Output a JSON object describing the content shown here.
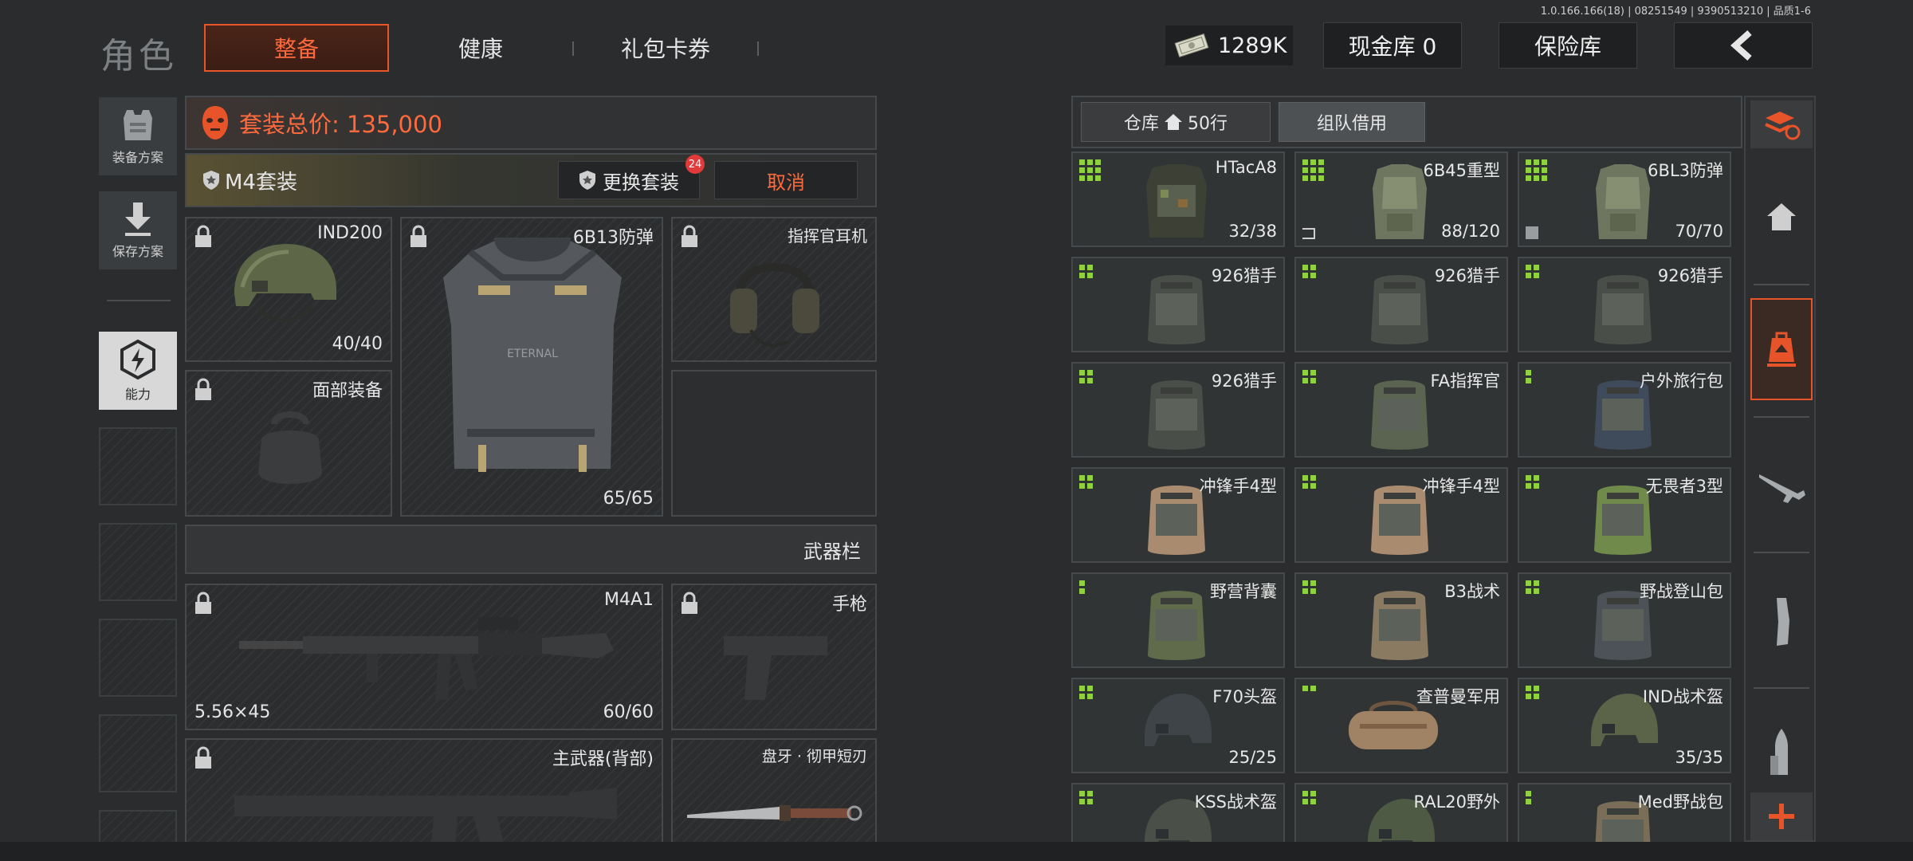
{
  "version_text": "1.0.166.166(18) | 08251549 | 9390513210 | 品质1-6",
  "header": {
    "title": "角色",
    "tabs": [
      {
        "label": "整备",
        "active": true
      },
      {
        "label": "健康",
        "active": false
      },
      {
        "label": "礼包卡券",
        "active": false
      }
    ],
    "currency_value": "1289K",
    "cash_vault_label": "现金库 0",
    "insurance_label": "保险库"
  },
  "left_rail": {
    "loadout_plan_label": "装备方案",
    "save_plan_label": "保存方案",
    "ability_label": "能力"
  },
  "loadout": {
    "total_price_label": "套装总价: 135,000",
    "set_name": "M4套装",
    "change_set_label": "更换套装",
    "change_set_badge": "24",
    "cancel_label": "取消",
    "slots": {
      "helmet": {
        "name": "IND200",
        "durability": "40/40"
      },
      "armor": {
        "name": "6B13防弹",
        "durability": "65/65"
      },
      "headset": {
        "name": "指挥官耳机"
      },
      "face": {
        "name": "面部装备"
      }
    },
    "weapon_bar_label": "武器栏",
    "weapons": {
      "primary": {
        "name": "M4A1",
        "caliber": "5.56×45",
        "durability": "60/60"
      },
      "pistol": {
        "name": "手枪"
      },
      "back": {
        "name": "主武器(背部)"
      },
      "melee": {
        "name": "盘牙 · 彻甲短刃"
      }
    }
  },
  "storage": {
    "warehouse_label": "仓库",
    "warehouse_rows": "50行",
    "team_borrow_label": "组队借用",
    "items": [
      {
        "name": "HTacA8",
        "durability": "32/38",
        "grid": "3x3",
        "kind": "vest"
      },
      {
        "name": "6B45重型",
        "durability": "88/120",
        "grid": "3x3",
        "kind": "armor"
      },
      {
        "name": "6BL3防弹",
        "durability": "70/70",
        "grid": "3x3",
        "kind": "armor"
      },
      {
        "name": "926猎手",
        "durability": "",
        "grid": "2x2",
        "kind": "bag"
      },
      {
        "name": "926猎手",
        "durability": "",
        "grid": "2x2",
        "kind": "bag"
      },
      {
        "name": "926猎手",
        "durability": "",
        "grid": "2x2",
        "kind": "bag"
      },
      {
        "name": "926猎手",
        "durability": "",
        "grid": "2x2",
        "kind": "bag"
      },
      {
        "name": "FA指挥官",
        "durability": "",
        "grid": "2x2",
        "kind": "bag"
      },
      {
        "name": "户外旅行包",
        "durability": "",
        "grid": "1x2",
        "kind": "bag"
      },
      {
        "name": "冲锋手4型",
        "durability": "",
        "grid": "2x2",
        "kind": "bag"
      },
      {
        "name": "冲锋手4型",
        "durability": "",
        "grid": "2x2",
        "kind": "bag"
      },
      {
        "name": "无畏者3型",
        "durability": "",
        "grid": "2x2",
        "kind": "bag"
      },
      {
        "name": "野营背囊",
        "durability": "",
        "grid": "1x2",
        "kind": "bag"
      },
      {
        "name": "B3战术",
        "durability": "",
        "grid": "2x2",
        "kind": "bag"
      },
      {
        "name": "野战登山包",
        "durability": "",
        "grid": "2x2",
        "kind": "bag"
      },
      {
        "name": "F70头盔",
        "durability": "25/25",
        "grid": "2x2",
        "kind": "helmet"
      },
      {
        "name": "查普曼军用",
        "durability": "",
        "grid": "2x1",
        "kind": "duffel"
      },
      {
        "name": "IND战术盔",
        "durability": "35/35",
        "grid": "2x2",
        "kind": "helmet"
      },
      {
        "name": "KSS战术盔",
        "durability": "",
        "grid": "2x2",
        "kind": "helmet"
      },
      {
        "name": "RAL20野外",
        "durability": "",
        "grid": "2x2",
        "kind": "helmet"
      },
      {
        "name": "Med野战包",
        "durability": "",
        "grid": "1x2",
        "kind": "bag"
      }
    ]
  },
  "colors": {
    "accent": "#e8542a",
    "grid_dot": "#8fd13f",
    "badge": "#e03a3a"
  },
  "icons": [
    "wad-icon",
    "back-arrow-icon",
    "armor-plan-icon",
    "save-download-icon",
    "ability-icon",
    "lock-icon",
    "shield-icon",
    "home-icon",
    "swap-stack-icon",
    "backpack-upload-icon",
    "rifle-icon",
    "magazine-icon",
    "ammo-icon",
    "plus-icon"
  ]
}
